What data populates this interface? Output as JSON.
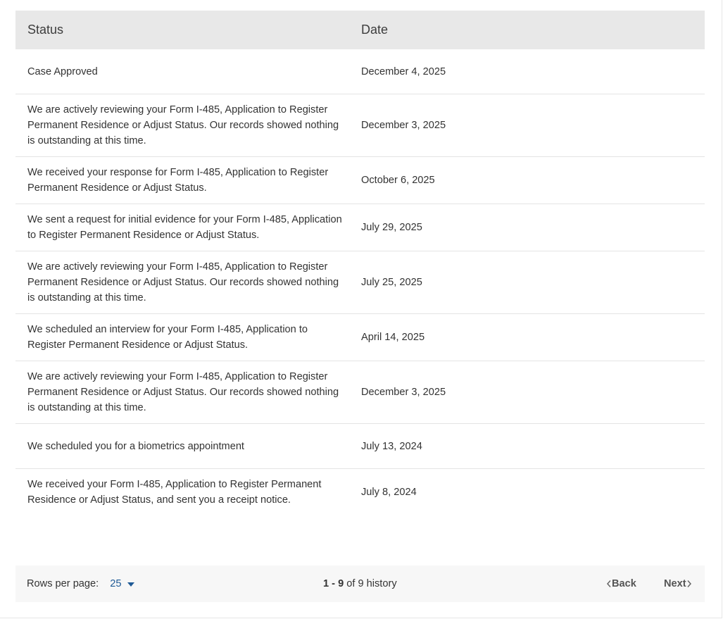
{
  "table": {
    "headers": {
      "status": "Status",
      "date": "Date"
    },
    "rows": [
      {
        "status": "Case Approved",
        "date": "December 4, 2025"
      },
      {
        "status": "We are actively reviewing your Form I-485, Application to Register Permanent Residence or Adjust Status. Our records showed nothing is outstanding at this time.",
        "date": "December 3, 2025"
      },
      {
        "status": "We received your response for Form I-485, Application to Register Permanent Residence or Adjust Status.",
        "date": "October 6, 2025"
      },
      {
        "status": "We sent a request for initial evidence for your Form I-485, Application to Register Permanent Residence or Adjust Status.",
        "date": "July 29, 2025"
      },
      {
        "status": "We are actively reviewing your Form I-485, Application to Register Permanent Residence or Adjust Status. Our records showed nothing is outstanding at this time.",
        "date": "July 25, 2025"
      },
      {
        "status": "We scheduled an interview for your Form I-485, Application to Register Permanent Residence or Adjust Status.",
        "date": "April 14, 2025"
      },
      {
        "status": "We are actively reviewing your Form I-485, Application to Register Permanent Residence or Adjust Status. Our records showed nothing is outstanding at this time.",
        "date": "December 3, 2025"
      },
      {
        "status": "We scheduled you for a biometrics appointment",
        "date": "July 13, 2024"
      },
      {
        "status": "We received your Form I-485, Application to Register Permanent Residence or Adjust Status, and sent you a receipt notice.",
        "date": "July 8, 2024"
      }
    ]
  },
  "pagination": {
    "rows_per_page_label": "Rows per page:",
    "rows_per_page_value": "25",
    "range": "1 - 9",
    "range_of": " of 9 history",
    "back_label": "Back",
    "next_label": "Next"
  },
  "icons": {
    "rows_select": "chevron-down-icon",
    "back": "chevron-left-icon",
    "next": "chevron-right-icon"
  },
  "colors": {
    "header_bg": "#e8e8e8",
    "pager_bg": "#f7f7f7",
    "link_blue": "#1f5a96",
    "nav_text": "#555555"
  }
}
